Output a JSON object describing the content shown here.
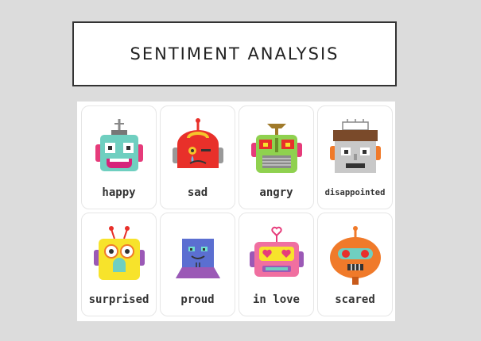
{
  "header": {
    "title": "SENTIMENT ANALYSIS"
  },
  "robots": [
    {
      "label": "happy",
      "icon": "happy-robot-icon"
    },
    {
      "label": "sad",
      "icon": "sad-robot-icon"
    },
    {
      "label": "angry",
      "icon": "angry-robot-icon"
    },
    {
      "label": "disappointed",
      "icon": "disappointed-robot-icon"
    },
    {
      "label": "surprised",
      "icon": "surprised-robot-icon"
    },
    {
      "label": "proud",
      "icon": "proud-robot-icon"
    },
    {
      "label": "in love",
      "icon": "in-love-robot-icon"
    },
    {
      "label": "scared",
      "icon": "scared-robot-icon"
    }
  ],
  "colors": {
    "background": "#dcdcdc",
    "happy": "#6fcfc0",
    "sad": "#e8302a",
    "angry": "#8fd14f",
    "disappointed": "#c8c8c8",
    "surprised": "#f7e32b",
    "proud": "#5b6fd1",
    "in_love": "#f06fa0",
    "scared": "#f07a2a"
  }
}
